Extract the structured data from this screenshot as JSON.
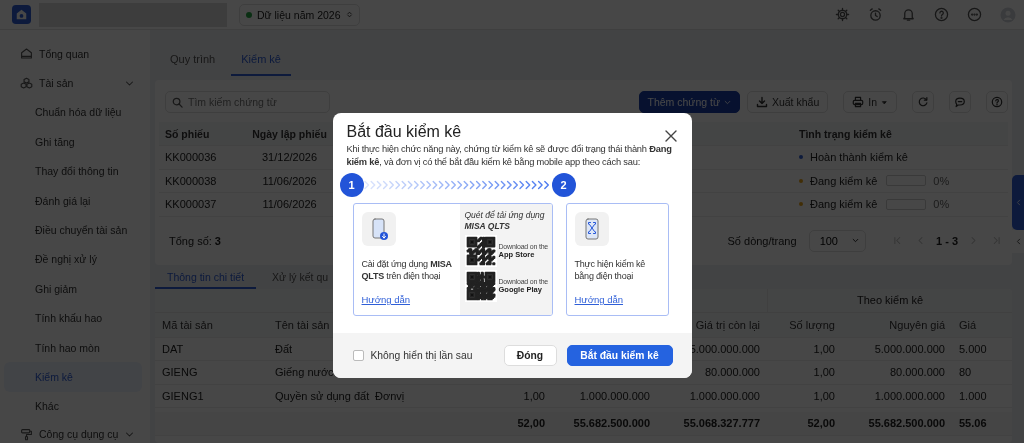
{
  "top_bar": {
    "data_year": "Dữ liệu năm 2026"
  },
  "sidebar": {
    "items": [
      {
        "label": "Tổng quan",
        "selected": false
      },
      {
        "label": "Tài sản",
        "selected": false,
        "expanded": true,
        "children": [
          {
            "label": "Chuẩn hóa dữ liệu",
            "selected": false
          },
          {
            "label": "Ghi tăng",
            "selected": false
          },
          {
            "label": "Thay đổi thông tin",
            "selected": false
          },
          {
            "label": "Đánh giá lại",
            "selected": false
          },
          {
            "label": "Điều chuyển tài sản",
            "selected": false
          },
          {
            "label": "Đề nghị xử lý",
            "selected": false
          },
          {
            "label": "Ghi giảm",
            "selected": false
          },
          {
            "label": "Tính khấu hao",
            "selected": false
          },
          {
            "label": "Tính hao mòn",
            "selected": false
          },
          {
            "label": "Kiểm kê",
            "selected": true
          },
          {
            "label": "Khác",
            "selected": false
          }
        ]
      },
      {
        "label": "Công cụ dụng cụ",
        "selected": false,
        "expanded": true
      }
    ]
  },
  "main_tabs": [
    {
      "label": "Quy trình",
      "selected": false
    },
    {
      "label": "Kiểm kê",
      "selected": true
    }
  ],
  "toolbar": {
    "search": {
      "placeholder": "Tìm kiếm chứng từ"
    },
    "add_button": "Thêm chứng từ",
    "export_button": "Xuất khẩu",
    "print_button": "In"
  },
  "vouchers": {
    "headers": {
      "number": "Số phiếu",
      "date": "Ngày lập phiếu",
      "status": "Tình trạng kiểm kê"
    },
    "rows": [
      {
        "number": "KK000036",
        "date": "31/12/2026",
        "status": {
          "label": "Hoàn thành kiểm kê",
          "color": "#0d1b3c",
          "kind": "done"
        }
      },
      {
        "number": "KK000038",
        "date": "11/06/2026",
        "status": {
          "label": "Đang kiểm kê",
          "color": "#412e06",
          "kind": "progress",
          "level": 0,
          "percent": "0%"
        }
      },
      {
        "number": "KK000037",
        "date": "11/06/2026",
        "status": {
          "label": "Đang kiểm kê",
          "color": "#412e06",
          "kind": "progress",
          "level": 0,
          "percent": "0%"
        }
      }
    ],
    "total": "Tổng số: **3**",
    "pager": {
      "rows_label": "Số dòng/trang",
      "page_size": "100",
      "range": "1 - 3"
    }
  },
  "detail_tabs": [
    {
      "label": "Thông tin chi tiết",
      "selected": true
    },
    {
      "label": "Xử lý kết qu",
      "selected": false
    }
  ],
  "assets": {
    "group_header": "Theo kiểm kê",
    "headers": {
      "asset_code": "Mã tài sản",
      "asset_name": "Tên tài sản",
      "remaining_value": "Giá trị còn lại",
      "counted_quantity": "Số lượng",
      "counted_original_cost": "Nguyên giá",
      "column_9": "Giá"
    },
    "rows": [
      {
        "asset_code": "DAT",
        "asset_name": "Đất",
        "remaining_value": "5.000.000.000",
        "counted_quantity": "1,00",
        "counted_original_cost": "5.000.000.000",
        "column_9": "5.000"
      },
      {
        "asset_code": "GIENG",
        "asset_name": "Giếng nước",
        "remaining_value": "80.000.000",
        "counted_quantity": "1,00",
        "counted_original_cost": "80.000.000",
        "column_9": "80"
      },
      {
        "asset_code": "GIENG1",
        "asset_name": "Quyền sử dụng đất",
        "column_3": "Đơnvị",
        "column_4": "1,00",
        "column_5": "1.000.000.000",
        "remaining_value": "1.000.000.000",
        "counted_quantity": "1,00",
        "counted_original_cost": "1.000.000.000",
        "column_9": "1.000"
      }
    ],
    "totals": {
      "column_4": "52,00",
      "column_5": "55.682.500.000",
      "remaining_value": "55.068.327.777",
      "counted_quantity": "52,00",
      "counted_original_cost": "55.682.500.000",
      "column_9": "55.06"
    }
  },
  "modal": {
    "title": "Bắt đầu kiểm kê",
    "description": "Khi thực hiện chức năng này, chứng từ kiểm kê sẽ được đổi trạng thái thành **Đang kiểm kê**, và đơn vị có thể bắt đầu kiểm kê bằng mobile app theo cách sau:",
    "steps": [
      {
        "number": "1",
        "text": "Cài đặt ứng dụng **MISA QLTS** trên điện thoại",
        "link": "Hướng dẫn",
        "download": {
          "caption": "Quét để tải ứng dụng **MISA QLTS**",
          "stores": [
            {
              "line1": "Download on the",
              "line2": "App Store"
            },
            {
              "line1": "Download on the",
              "line2": "Google Play"
            }
          ]
        }
      },
      {
        "number": "2",
        "text": "Thực hiện kiểm kê bằng điện thoại",
        "link": "Hướng dẫn"
      }
    ],
    "dont_show": {
      "label": "Không hiển thị lần sau",
      "checked": false
    },
    "buttons": [
      {
        "label": "Đóng",
        "kind": "secondary"
      },
      {
        "label": "Bắt đầu kiểm kê",
        "kind": "primary"
      }
    ]
  }
}
